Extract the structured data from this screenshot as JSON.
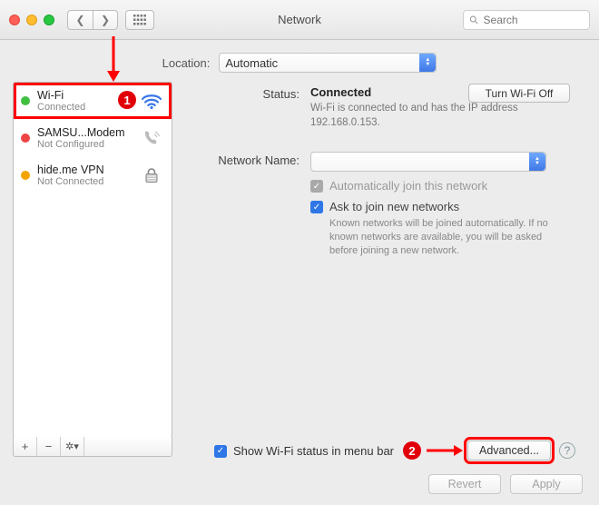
{
  "window": {
    "title": "Network",
    "search_placeholder": "Search"
  },
  "location": {
    "label": "Location:",
    "value": "Automatic"
  },
  "sidebar": {
    "services": [
      {
        "name": "Wi-Fi",
        "status": "Connected",
        "dot": "green",
        "icon": "wifi",
        "selected": true
      },
      {
        "name": "SAMSU...Modem",
        "status": "Not Configured",
        "dot": "red",
        "icon": "phone",
        "selected": false
      },
      {
        "name": "hide.me VPN",
        "status": "Not Connected",
        "dot": "orange",
        "icon": "lock",
        "selected": false
      }
    ]
  },
  "detail": {
    "status_label": "Status:",
    "status_value": "Connected",
    "turn_off": "Turn Wi-Fi Off",
    "status_sub": "Wi-Fi is connected to            and has the IP address 192.168.0.153.",
    "network_name_label": "Network Name:",
    "network_name_value": " ",
    "auto_join": "Automatically join this network",
    "ask_join": "Ask to join new networks",
    "ask_help": "Known networks will be joined automatically. If no known networks are available, you will be asked before joining a new network."
  },
  "bottom": {
    "menubar": "Show Wi-Fi status in menu bar",
    "advanced": "Advanced...",
    "revert": "Revert",
    "apply": "Apply"
  },
  "annotations": {
    "badge1": "1",
    "badge2": "2"
  }
}
